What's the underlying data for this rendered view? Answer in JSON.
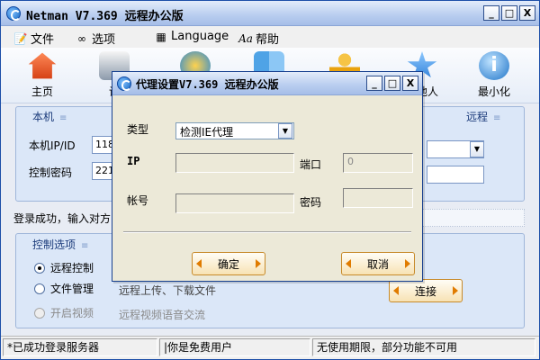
{
  "window": {
    "title": "Netman V7.369 远程办公版",
    "controls": [
      "_",
      "□",
      "X"
    ]
  },
  "menu": [
    {
      "icon": "document-icon",
      "label": "文件"
    },
    {
      "icon": "glasses-icon",
      "label": "选项"
    },
    {
      "icon": "language-icon",
      "label": "Language"
    },
    {
      "icon": "help-icon",
      "label": "帮助"
    }
  ],
  "toolbar": {
    "items": [
      {
        "name": "home",
        "label": "主页"
      },
      {
        "name": "settings",
        "label": "设"
      },
      {
        "name": "network",
        "label": ""
      },
      {
        "name": "finder",
        "label": ""
      },
      {
        "name": "user",
        "label": ""
      },
      {
        "name": "join",
        "label": "他人"
      },
      {
        "name": "minimize",
        "label": "最小化"
      }
    ]
  },
  "local_panel": {
    "header": "本机",
    "remote_header": "远程",
    "ip_label": "本机IP/ID",
    "ip_value": "118.",
    "password_label": "控制密码",
    "password_value": "2210"
  },
  "login_status": "登录成功，输入对方",
  "control_panel": {
    "header": "控制选项",
    "options": [
      {
        "label": "远程控制",
        "selected": true,
        "disabled": false
      },
      {
        "label": "文件管理",
        "selected": false,
        "disabled": false,
        "description": "远程上传、下载文件"
      },
      {
        "label": "开启视频",
        "selected": false,
        "disabled": true,
        "description": "远程视频语音交流"
      }
    ],
    "connect_button": "连接"
  },
  "statusbar": {
    "server": "*已成功登录服务器",
    "user_type": "|你是免费用户",
    "license": "无使用期限，部分功能不可用"
  },
  "dialog": {
    "title": "代理设置V7.369 远程办公版",
    "type_label": "类型",
    "type_value": "检测IE代理",
    "ip_label": "IP",
    "ip_value": "",
    "port_label": "端口",
    "port_value": "0",
    "account_label": "帐号",
    "account_value": "",
    "password_label": "密码",
    "password_value": "",
    "ok_button": "确定",
    "cancel_button": "取消"
  }
}
